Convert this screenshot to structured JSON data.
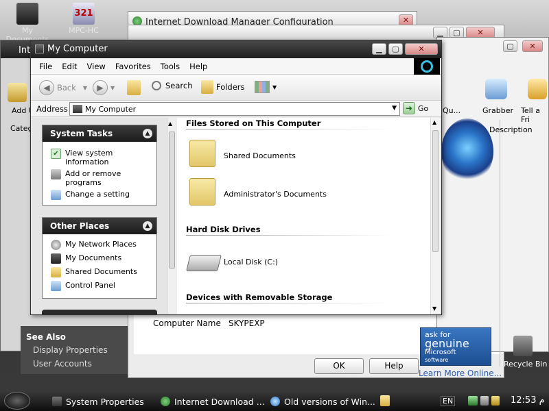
{
  "desktop": {
    "icons": [
      {
        "label": "My Documents",
        "icon": "my-documents-icon"
      },
      {
        "label": "MPC-HC",
        "icon": "media-player-icon"
      }
    ],
    "see_also": {
      "title": "See Also",
      "items": [
        "Display Properties",
        "User Accounts"
      ]
    },
    "recycle_bin": "Recycle Bin",
    "genuine": {
      "line1": "ask for",
      "line2": "genuine",
      "line3": "Microsoft",
      "line4": "software",
      "link": "Learn More Online..."
    }
  },
  "idm_window": {
    "title": "Internet Download Manager Configuration"
  },
  "back_window": {
    "title_partial": "Int",
    "toolbar_labels": [
      "Qu...",
      "Grabber",
      "Tell a Fri"
    ],
    "add_label": "Add U",
    "description_header": "Description",
    "categ": "Categ"
  },
  "system_properties": {
    "computer_name_label": "Computer Name",
    "computer_name_value": "SKYPEXP",
    "ok": "OK",
    "help": "Help"
  },
  "explorer": {
    "title": "My Computer",
    "menu": [
      "File",
      "Edit",
      "View",
      "Favorites",
      "Tools",
      "Help"
    ],
    "toolbar": {
      "back": "Back",
      "search": "Search",
      "folders": "Folders"
    },
    "address": {
      "label": "Address",
      "value": "My Computer",
      "go": "Go"
    },
    "system_tasks": {
      "title": "System Tasks",
      "items": [
        {
          "label": "View system information",
          "icon": "system-info-icon"
        },
        {
          "label": "Add or remove programs",
          "icon": "add-remove-icon"
        },
        {
          "label": "Change a setting",
          "icon": "control-panel-icon"
        }
      ]
    },
    "other_places": {
      "title": "Other Places",
      "items": [
        {
          "label": "My Network Places",
          "icon": "network-icon"
        },
        {
          "label": "My Documents",
          "icon": "documents-icon"
        },
        {
          "label": "Shared Documents",
          "icon": "folder-icon"
        },
        {
          "label": "Control Panel",
          "icon": "control-panel-icon"
        }
      ]
    },
    "sections": {
      "files": "Files Stored on This Computer",
      "hdd": "Hard Disk Drives",
      "removable": "Devices with Removable Storage"
    },
    "files": [
      "Shared Documents",
      "Administrator's Documents"
    ],
    "drives": [
      "Local Disk (C:)"
    ]
  },
  "taskbar": {
    "tasks": [
      "System Properties",
      "Internet Download ...",
      "Old versions of Win..."
    ],
    "language": "EN",
    "clock": "12:53 م"
  },
  "colors": {
    "taskbar": "#1a1a1a",
    "titlebar": "#2a2a2a",
    "accent": "#2a5db0"
  }
}
